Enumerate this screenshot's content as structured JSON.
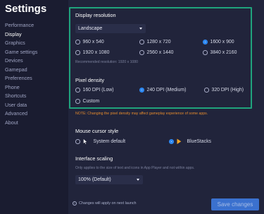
{
  "sidebar": {
    "title": "Settings",
    "items": [
      {
        "label": "Performance"
      },
      {
        "label": "Display"
      },
      {
        "label": "Graphics"
      },
      {
        "label": "Game settings"
      },
      {
        "label": "Devices"
      },
      {
        "label": "Gamepad"
      },
      {
        "label": "Preferences"
      },
      {
        "label": "Phone"
      },
      {
        "label": "Shortcuts"
      },
      {
        "label": "User data"
      },
      {
        "label": "Advanced"
      },
      {
        "label": "About"
      }
    ],
    "active_index": 1
  },
  "display_resolution": {
    "title": "Display resolution",
    "orientation": "Landscape",
    "options": [
      "960 x 540",
      "1280 x 720",
      "1600 x 900",
      "1920 x 1080",
      "2560 x 1440",
      "3840 x 2160"
    ],
    "selected": "1600 x 900",
    "recommended": "Recommended resolution: 1920 x 1080"
  },
  "pixel_density": {
    "title": "Pixel density",
    "options": [
      "160 DPI (Low)",
      "240 DPI (Medium)",
      "320 DPI (High)",
      "Custom"
    ],
    "selected": "240 DPI (Medium)",
    "note": "NOTE: Changing the pixel density may affect gameplay experience of some apps."
  },
  "mouse_cursor": {
    "title": "Mouse cursor style",
    "options": [
      "System default",
      "BlueStacks"
    ],
    "selected": "BlueStacks"
  },
  "interface_scaling": {
    "title": "Interface scaling",
    "hint": "Only applies to the size of text and icons in App Player and not within apps.",
    "value": "100% (Default)"
  },
  "footer": {
    "note": "Changes will apply on next launch",
    "save_label": "Save changes"
  },
  "colors": {
    "accent": "#2e88f0",
    "highlight_border": "#1fa37c",
    "note": "#e48a2d",
    "cursor_brand": "#f5a623"
  },
  "icons": {
    "system_cursor": "arrow-cursor-icon",
    "bluestacks_cursor": "bluestacks-cursor-icon",
    "info": "info-icon",
    "dropdown": "chevron-down-icon"
  }
}
